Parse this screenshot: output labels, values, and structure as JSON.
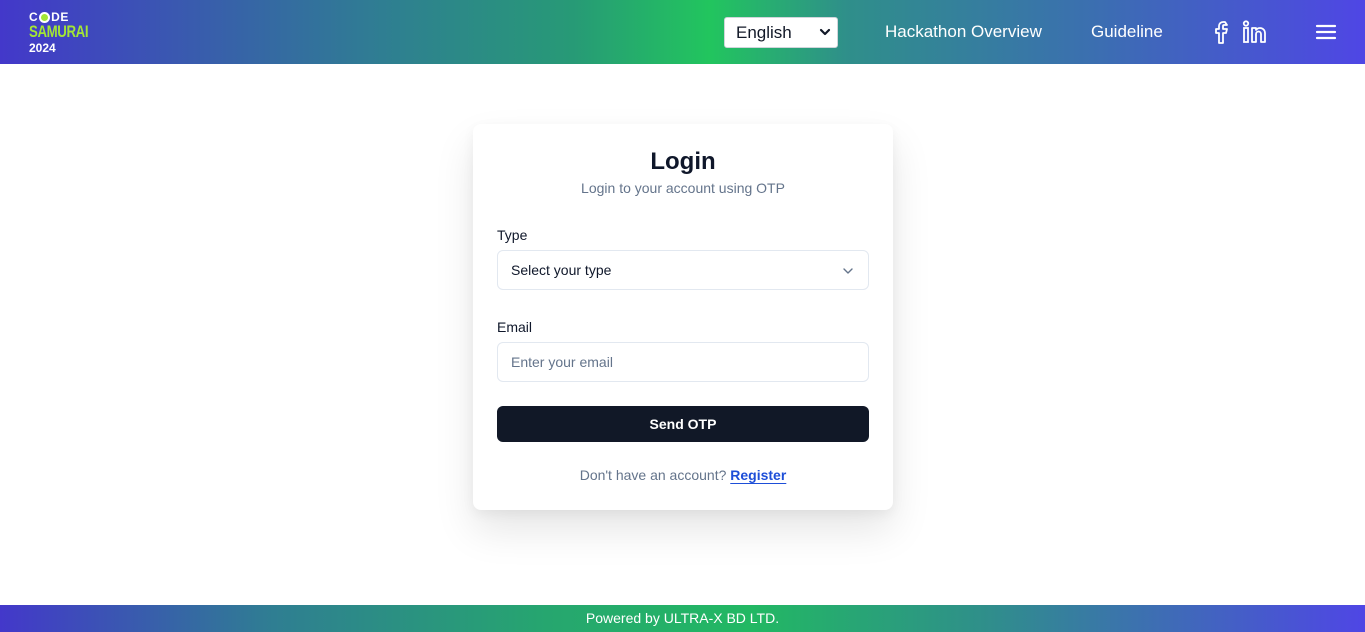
{
  "header": {
    "logo": {
      "line1_part1": "C",
      "line1_part2": "DE",
      "line2": "SAMURAI",
      "line3": "2024"
    },
    "language": {
      "selected": "English"
    },
    "nav": {
      "overview": "Hackathon Overview",
      "guideline": "Guideline"
    },
    "icons": {
      "facebook": "facebook-icon",
      "linkedin": "linkedin-icon",
      "menu": "hamburger-menu-icon"
    }
  },
  "login": {
    "title": "Login",
    "subtitle": "Login to your account using OTP",
    "type_label": "Type",
    "type_placeholder": "Select your type",
    "email_label": "Email",
    "email_placeholder": "Enter your email",
    "email_value": "",
    "submit_label": "Send OTP",
    "register_prompt": "Don't have an account?",
    "register_link": "Register"
  },
  "footer": {
    "text": "Powered by ULTRA-X BD LTD."
  },
  "colors": {
    "primary_button": "#111827",
    "link": "#1d4ed8",
    "logo_accent": "#a3e635"
  }
}
